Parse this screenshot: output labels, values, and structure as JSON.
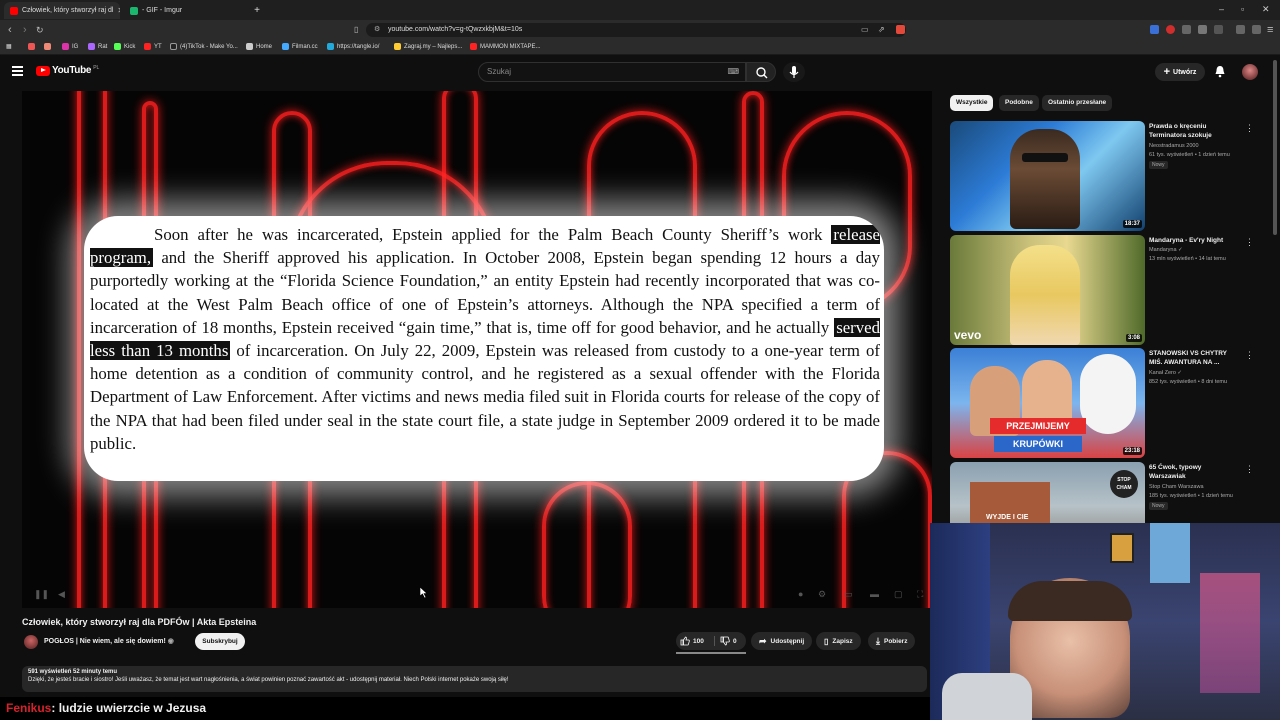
{
  "browser": {
    "tabs": [
      {
        "label": "Człowiek, który stworzył raj dl"
      },
      {
        "label": "- GIF - Imgur"
      }
    ],
    "new_tab": "+",
    "url": "youtube.com/watch?v=g-tQwzxkbjM&t=10s",
    "bookmarks": [
      "IG",
      "Rat",
      "Kick",
      "YT",
      "(4)TikTok - Make Yo...",
      "Home",
      "Filman.cc",
      "https://tangle.io/",
      "Zagraj.my – Najleps...",
      "MAMMON MIXTAPE..."
    ],
    "colors": {
      "yt_red": "#ff0000",
      "chat_user": "#d6222c",
      "neon": "#ff2020"
    }
  },
  "header": {
    "logo_text": "YouTube",
    "logo_region": "PL",
    "search_placeholder": "Szukaj",
    "create_label": "Utwórz"
  },
  "video": {
    "doc_lines": [
      "Soon after he was incarcerated, Epstein applied for the Palm Beach County Sheriff’s work",
      "release program,",
      " and the Sheriff approved his application.  In October 2008, Epstein began spending 12 hours a day purportedly working at the “Florida Science Foundation,” an entity Epstein had recently incorporated that was co-located at the West Palm Beach office of one of Epstein’s attorneys.  Although the NPA specified a term of incarceration of 18 months, Epstein received “gain time,” that is, time off for good behavior, and he actually ",
      "served less than 13 months",
      " of incarceration.  On July 22, 2009, Epstein was released from custody to a one-year term of home detention as a condition of community control, and he registered as a sexual offender with the Florida Department of Law Enforcement.  After victims and news media filed suit in Florida courts for release of the copy of the NPA that had been filed under seal in the state court file, a state judge in September 2009 ordered it to be made public."
    ],
    "title": "Człowiek, który stworzył raj dla PDFÓw | Akta Epsteina",
    "channel": "POGŁOS | Nie wiem, ale się dowiem!",
    "subscribe_label": "Subskrybuj",
    "likes": "100",
    "dislikes": "0",
    "share_label": "Udostępnij",
    "save_label": "Zapisz",
    "download_label": "Pobierz",
    "views_meta": "591 wyświetleń  52 minuty temu",
    "description": "Dzięki, że jesteś bracie i siostro! Jeśli uważasz, że temat jest wart nagłośnienia, a świat powinien poznać zawartość akt - udostępnij materiał. Niech Polski internet pokaże swoją siłę!"
  },
  "sidebar": {
    "chips": [
      "Wszystkie",
      "Podobne",
      "Ostatnio przesłane"
    ],
    "items": [
      {
        "title": "Prawda o kręceniu Terminatora szokuje",
        "channel": "Neostradamus 2000",
        "meta": "61 tys. wyświetleń • 1 dzień temu",
        "badge": "Nowy",
        "duration": "18:37"
      },
      {
        "title": "Mandaryna - Ev'ry Night",
        "channel": "Mandaryna ✓",
        "meta": "13 mln wyświetleń • 14 lat temu",
        "badge": "",
        "duration": "3:08"
      },
      {
        "title": "STANOWSKI VS CHYTRY MIŚ. AWANTURA NA ...",
        "channel": "Kanał Zero ✓",
        "meta": "852 tys. wyświetleń • 8 dni temu",
        "badge": "",
        "duration": "23:18"
      },
      {
        "title": "65 Ćwok, typowy Warszawiak",
        "channel": "Stop Cham Warszawa",
        "meta": "185 tys. wyświetleń • 1 dzień temu",
        "badge": "Nowy",
        "duration": ""
      }
    ],
    "thumb_texts": [
      "vevo",
      "PRZEJMIJEMY",
      "KRUPÓWKI",
      "STOP CHAM",
      "WYJDE I CIE"
    ]
  },
  "chat": {
    "user": "Fenikus",
    "message": ": ludzie uwierzcie w Jezusa"
  }
}
